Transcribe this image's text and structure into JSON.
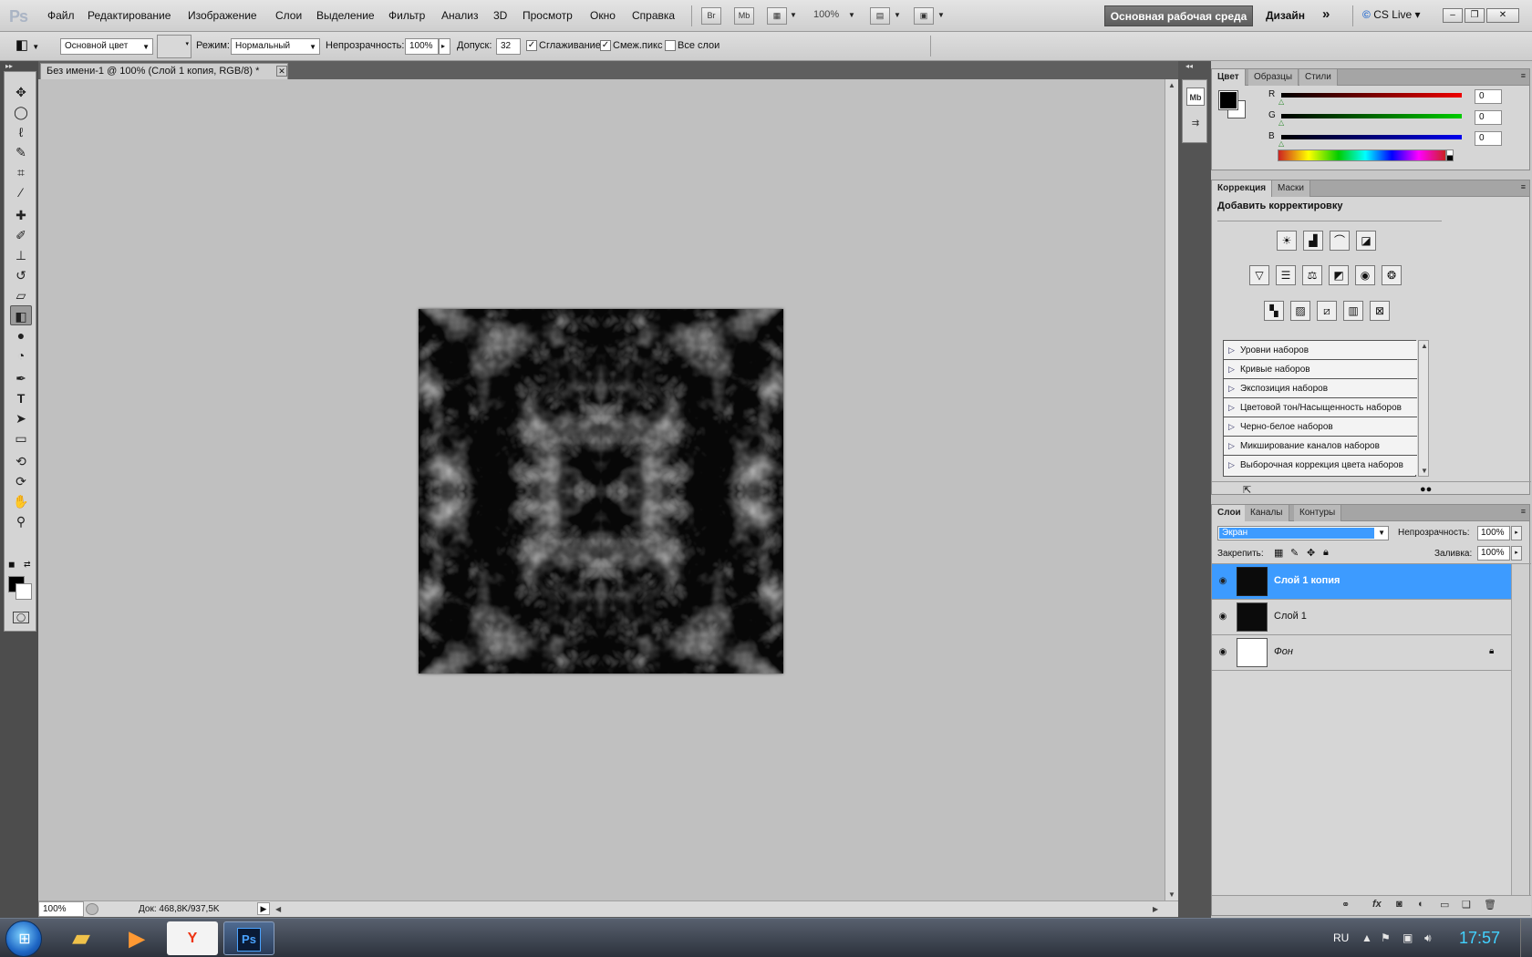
{
  "app": {
    "logo": "Ps"
  },
  "menu": [
    "Файл",
    "Редактирование",
    "Изображение",
    "Слои",
    "Выделение",
    "Фильтр",
    "Анализ",
    "3D",
    "Просмотр",
    "Окно",
    "Справка"
  ],
  "appbar": {
    "bridge": "Br",
    "minibridge": "Mb",
    "zoom": "100%",
    "workspace": "Основная рабочая среда",
    "design": "Дизайн",
    "more": "»",
    "cslive": "CS Live"
  },
  "options": {
    "fill_source": "Основной цвет",
    "mode_label": "Режим:",
    "mode_value": "Нормальный",
    "opacity_label": "Непрозрачность:",
    "opacity_value": "100%",
    "tolerance_label": "Допуск:",
    "tolerance_value": "32",
    "antialias_label": "Сглаживание",
    "antialias_checked": true,
    "contiguous_label": "Смеж.пикс",
    "contiguous_checked": true,
    "all_layers_label": "Все слои",
    "all_layers_checked": false
  },
  "document": {
    "tab_title": "Без имени-1 @ 100% (Слой 1 копия, RGB/8) *",
    "close": "✕",
    "status_zoom": "100%",
    "status_doc": "Док: 468,8K/937,5K"
  },
  "tools": [
    {
      "name": "move-tool",
      "glyph": "✥"
    },
    {
      "name": "marquee-tool",
      "glyph": "◯"
    },
    {
      "name": "lasso-tool",
      "glyph": "ℓ"
    },
    {
      "name": "quick-selection-tool",
      "glyph": "✎"
    },
    {
      "name": "crop-tool",
      "glyph": "⌗"
    },
    {
      "name": "eyedropper-tool",
      "glyph": "⁄"
    },
    {
      "name": "healing-brush-tool",
      "glyph": "✚"
    },
    {
      "name": "brush-tool",
      "glyph": "✐"
    },
    {
      "name": "clone-stamp-tool",
      "glyph": "⊥"
    },
    {
      "name": "history-brush-tool",
      "glyph": "↺"
    },
    {
      "name": "eraser-tool",
      "glyph": "▱"
    },
    {
      "name": "paint-bucket-tool",
      "glyph": "◧"
    },
    {
      "name": "blur-tool",
      "glyph": "●"
    },
    {
      "name": "dodge-tool",
      "glyph": "◔"
    },
    {
      "name": "pen-tool",
      "glyph": "✒"
    },
    {
      "name": "type-tool",
      "glyph": "T"
    },
    {
      "name": "path-selection-tool",
      "glyph": "➤"
    },
    {
      "name": "shape-tool",
      "glyph": "▭"
    },
    {
      "name": "3d-rotate-tool",
      "glyph": "⟲"
    },
    {
      "name": "3d-orbit-tool",
      "glyph": "⟳"
    },
    {
      "name": "hand-tool",
      "glyph": "✋"
    },
    {
      "name": "zoom-tool",
      "glyph": "⚲"
    }
  ],
  "active_tool": "paint-bucket-tool",
  "color_panel": {
    "tabs": [
      "Цвет",
      "Образцы",
      "Стили"
    ],
    "r_label": "R",
    "g_label": "G",
    "b_label": "B",
    "r": "0",
    "g": "0",
    "b": "0",
    "foreground": "#000000",
    "background": "#ffffff"
  },
  "adjust_panel": {
    "tabs": [
      "Коррекция",
      "Маски"
    ],
    "heading": "Добавить корректировку",
    "presets": [
      "Уровни наборов",
      "Кривые наборов",
      "Экспозиция наборов",
      "Цветовой тон/Насыщенность наборов",
      "Черно-белое наборов",
      "Микширование каналов наборов",
      "Выборочная коррекция цвета наборов"
    ]
  },
  "layers_panel": {
    "tabs": [
      "Слои",
      "Каналы",
      "Контуры"
    ],
    "blend_mode": "Экран",
    "opacity_label": "Непрозрачность:",
    "opacity_value": "100%",
    "lock_label": "Закрепить:",
    "fill_label": "Заливка:",
    "fill_value": "100%",
    "layers": [
      {
        "name": "Слой 1 копия",
        "selected": true,
        "thumb": "dark"
      },
      {
        "name": "Слой 1",
        "selected": false,
        "thumb": "dark"
      },
      {
        "name": "Фон",
        "selected": false,
        "thumb": "white",
        "locked": true
      }
    ]
  },
  "taskbar": {
    "lang": "RU",
    "clock": "17:57",
    "apps": [
      "explorer",
      "media-player",
      "yandex-browser",
      "photoshop"
    ],
    "ps_label": "Ps",
    "yandex_label": "Y"
  }
}
